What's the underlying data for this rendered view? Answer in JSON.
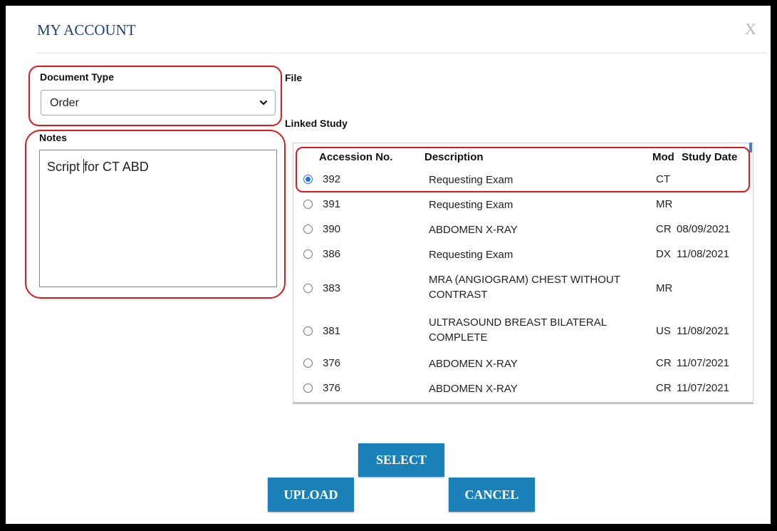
{
  "dialog": {
    "title": "MY ACCOUNT",
    "close_label": "X"
  },
  "form": {
    "document_type_label": "Document Type",
    "document_type_value": "Order",
    "notes_label": "Notes",
    "notes_value_before_caret": "Script ",
    "notes_value_after_caret": "for CT ABD",
    "file_label": "File",
    "linked_study_label": "Linked Study"
  },
  "table": {
    "headers": {
      "accession": "Accession No.",
      "description": "Description",
      "mod": "Mod",
      "study_date": "Study Date"
    },
    "rows": [
      {
        "selected": true,
        "accession": "392",
        "description": [
          "Requesting Exam"
        ],
        "mod": "CT",
        "date": ""
      },
      {
        "selected": false,
        "accession": "391",
        "description": [
          "Requesting Exam"
        ],
        "mod": "MR",
        "date": ""
      },
      {
        "selected": false,
        "accession": "390",
        "description": [
          "ABDOMEN X-RAY"
        ],
        "mod": "CR",
        "date": "08/09/2021"
      },
      {
        "selected": false,
        "accession": "386",
        "description": [
          "Requesting Exam"
        ],
        "mod": "DX",
        "date": "11/08/2021"
      },
      {
        "selected": false,
        "accession": "383",
        "description": [
          "MRA (ANGIOGRAM) CHEST WITHOUT",
          "CONTRAST"
        ],
        "mod": "MR",
        "date": ""
      },
      {
        "selected": false,
        "accession": "381",
        "description": [
          "ULTRASOUND BREAST BILATERAL",
          "COMPLETE"
        ],
        "mod": "US",
        "date": "11/08/2021"
      },
      {
        "selected": false,
        "accession": "376",
        "description": [
          "ABDOMEN X-RAY"
        ],
        "mod": "CR",
        "date": "11/07/2021"
      },
      {
        "selected": false,
        "accession": "376",
        "description": [
          "ABDOMEN X-RAY"
        ],
        "mod": "CR",
        "date": "11/07/2021"
      }
    ]
  },
  "buttons": {
    "select": "SELECT",
    "upload": "UPLOAD",
    "cancel": "CANCEL"
  },
  "colors": {
    "accent": "#1a82b8",
    "title": "#1f3f7a",
    "highlight": "#e0181b",
    "radio": "#1a73e8"
  },
  "icons": {
    "close": "close-icon",
    "dropdown": "chevron-down-icon"
  }
}
